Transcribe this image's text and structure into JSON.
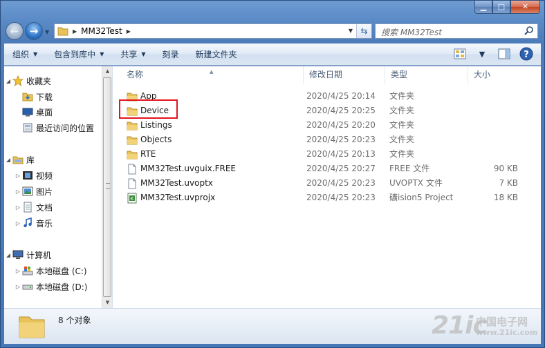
{
  "window": {
    "caption_min": "▁",
    "caption_max": "□",
    "caption_close": "✕"
  },
  "nav": {
    "back_glyph": "←",
    "forward_glyph": "→",
    "breadcrumb": "MM32Test",
    "search_placeholder": "搜索 MM32Test"
  },
  "toolbar": {
    "organize": "组织",
    "include_in_library": "包含到库中",
    "share": "共享",
    "burn": "刻录",
    "new_folder": "新建文件夹"
  },
  "sidebar": {
    "favorites": "收藏夹",
    "downloads": "下载",
    "desktop": "桌面",
    "recent_places": "最近访问的位置",
    "libraries": "库",
    "videos": "视频",
    "pictures": "图片",
    "documents": "文档",
    "music": "音乐",
    "computer": "计算机",
    "drive_c": "本地磁盘 (C:)",
    "drive_d": "本地磁盘 (D:)"
  },
  "columns": {
    "name": "名称",
    "date": "修改日期",
    "type": "类型",
    "size": "大小"
  },
  "files": [
    {
      "name": "App",
      "date": "2020/4/25 20:14",
      "type": "文件夹",
      "size": "",
      "icon": "folder-icon"
    },
    {
      "name": "Device",
      "date": "2020/4/25 20:25",
      "type": "文件夹",
      "size": "",
      "icon": "folder-icon"
    },
    {
      "name": "Listings",
      "date": "2020/4/25 20:20",
      "type": "文件夹",
      "size": "",
      "icon": "folder-icon"
    },
    {
      "name": "Objects",
      "date": "2020/4/25 20:23",
      "type": "文件夹",
      "size": "",
      "icon": "folder-icon"
    },
    {
      "name": "RTE",
      "date": "2020/4/25 20:13",
      "type": "文件夹",
      "size": "",
      "icon": "folder-icon"
    },
    {
      "name": "MM32Test.uvguix.FREE",
      "date": "2020/4/25 20:27",
      "type": "FREE 文件",
      "size": "90 KB",
      "icon": "document-icon"
    },
    {
      "name": "MM32Test.uvoptx",
      "date": "2020/4/25 20:23",
      "type": "UVOPTX 文件",
      "size": "7 KB",
      "icon": "document-icon"
    },
    {
      "name": "MM32Test.uvprojx",
      "date": "2020/4/25 20:23",
      "type": "礦ision5 Project",
      "size": "18 KB",
      "icon": "keil-project-icon"
    }
  ],
  "status": {
    "item_count": "8 个对象"
  },
  "watermark": {
    "logo": "21ic",
    "cn": "中国电子网",
    "url": "www.21ic.com"
  },
  "colors": {
    "highlight_box": "#e2141c",
    "folder": "#e9c35a"
  }
}
